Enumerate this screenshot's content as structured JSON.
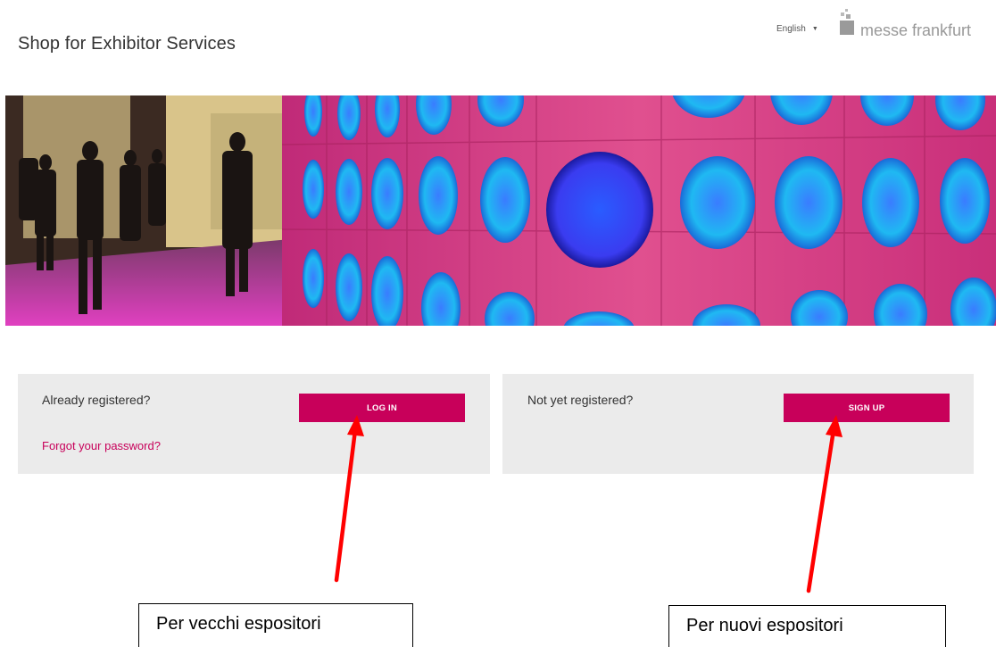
{
  "header": {
    "title": "Shop for Exhibitor Services",
    "language": "English",
    "logo_text": "messe frankfurt"
  },
  "login_panel": {
    "heading": "Already registered?",
    "button_label": "LOG IN",
    "forgot_link": "Forgot your password?"
  },
  "signup_panel": {
    "heading": "Not yet registered?",
    "button_label": "SIGN UP"
  },
  "annotations": {
    "old_exhibitors": "Per vecchi espositori",
    "new_exhibitors": "Per nuovi espositori",
    "arrow_color": "#ff0000"
  },
  "colors": {
    "accent": "#c8005a",
    "panel_bg": "#ebebeb",
    "banner_wall": "#d4317f",
    "banner_lights": "#1ec8f0"
  }
}
